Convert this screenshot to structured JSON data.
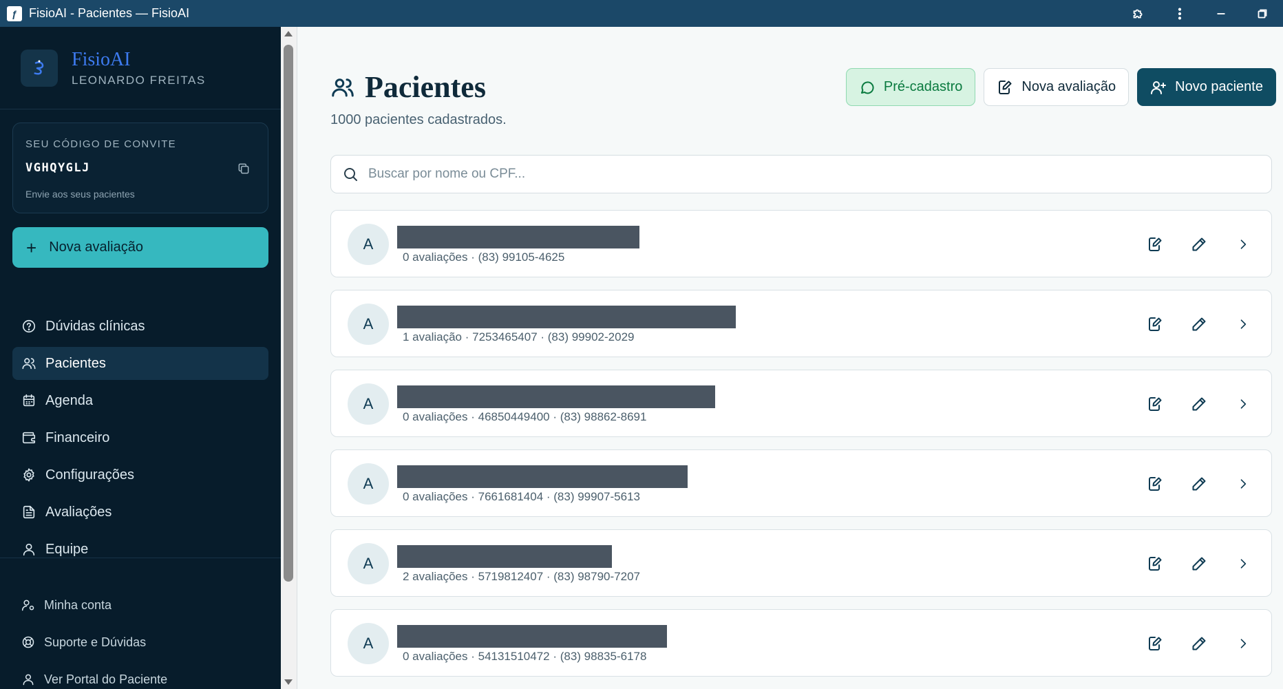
{
  "window": {
    "title": "FisioAI - Pacientes — FisioAI",
    "app_icon": "fisioai-icon"
  },
  "sidebar": {
    "brand_name": "FisioAI",
    "user_name": "LEONARDO FREITAS",
    "invite": {
      "label": "SEU CÓDIGO DE CONVITE",
      "code": "VGHQYGLJ",
      "hint": "Envie aos seus pacientes"
    },
    "new_eval_label": "Nova avaliação",
    "nav": [
      {
        "label": "Dúvidas clínicas",
        "icon": "help-circle-icon"
      },
      {
        "label": "Pacientes",
        "icon": "users-icon",
        "active": true
      },
      {
        "label": "Agenda",
        "icon": "calendar-icon"
      },
      {
        "label": "Financeiro",
        "icon": "wallet-icon"
      },
      {
        "label": "Configurações",
        "icon": "gear-icon"
      },
      {
        "label": "Avaliações",
        "icon": "document-icon"
      },
      {
        "label": "Equipe",
        "icon": "user-icon"
      }
    ],
    "footer": [
      {
        "label": "Minha conta",
        "icon": "user-cog-icon"
      },
      {
        "label": "Suporte e Dúvidas",
        "icon": "lifebuoy-icon"
      },
      {
        "label": "Ver Portal do Paciente",
        "icon": "user-icon"
      }
    ]
  },
  "main": {
    "title": "Pacientes",
    "subtitle": "1000 pacientes cadastrados.",
    "actions": {
      "pre_cadastro": "Pré-cadastro",
      "nova_avaliacao": "Nova avaliação",
      "novo_paciente": "Novo paciente"
    },
    "search_placeholder": "Buscar por nome ou CPF...",
    "patients": [
      {
        "initial": "A",
        "meta": "0 avaliações · (83) 99105-4625"
      },
      {
        "initial": "A",
        "meta": "1 avaliação · 7253465407 · (83) 99902-2029"
      },
      {
        "initial": "A",
        "meta": "0 avaliações · 46850449400 · (83) 98862-8691"
      },
      {
        "initial": "A",
        "meta": "0 avaliações · 7661681404 · (83) 99907-5613"
      },
      {
        "initial": "A",
        "meta": "2 avaliações · 5719812407 · (83) 98790-7207"
      },
      {
        "initial": "A",
        "meta": "0 avaliações · 54131510472 · (83) 98835-6178"
      }
    ]
  },
  "colors": {
    "sidebar_bg": "#071c2b",
    "titlebar_bg": "#1b4868",
    "accent_teal": "#36b8bf",
    "primary_button": "#0f4c62",
    "pre_cadastro_bg": "#d7f3e2"
  }
}
